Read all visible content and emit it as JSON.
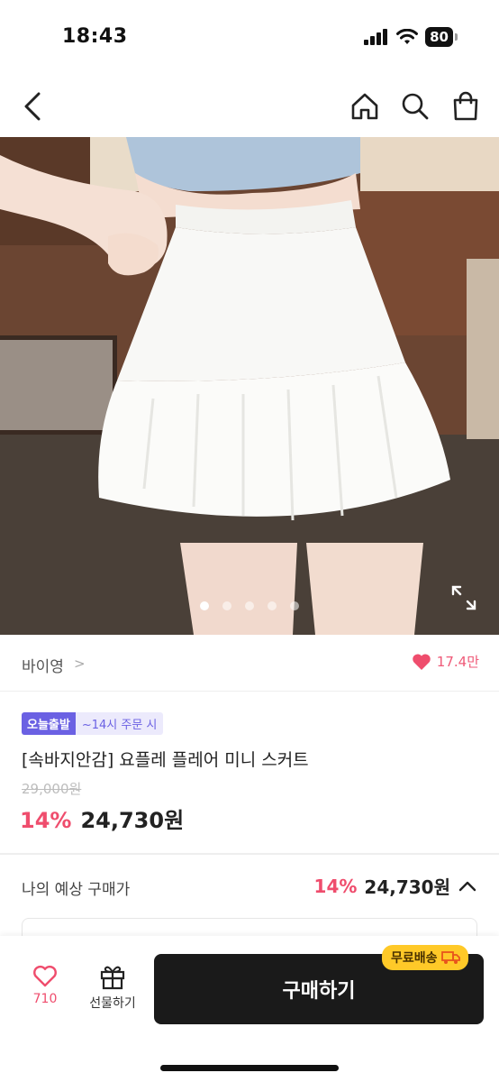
{
  "status_bar": {
    "time": "18:43",
    "battery": "80"
  },
  "nav": {
    "back_icon": "chevron-left-icon",
    "icons": [
      "home-icon",
      "search-icon",
      "shopping-bag-icon"
    ]
  },
  "gallery": {
    "image_count": 5,
    "active_index": 0
  },
  "seller": {
    "name": "바이영",
    "chevron": ">",
    "likes": "17.4만"
  },
  "product": {
    "badge_primary": "오늘출발",
    "badge_secondary": "~14시 주문 시",
    "title": "[속바지안감] 요플레 플레어 미니 스커트",
    "original_price": "29,000원",
    "discount": "14%",
    "sale_price": "24,730원"
  },
  "expected": {
    "label": "나의 예상 구매가",
    "discount": "14%",
    "price": "24,730원"
  },
  "bottom_bar": {
    "wish_count": "710",
    "gift_label": "선물하기",
    "buy_label": "구매하기",
    "shipping_badge": "무료배송"
  },
  "colors": {
    "accent": "#ef4d6d",
    "badge": "#6b61e3",
    "shipping": "#ffc928",
    "buy_button": "#1a1a1a"
  }
}
